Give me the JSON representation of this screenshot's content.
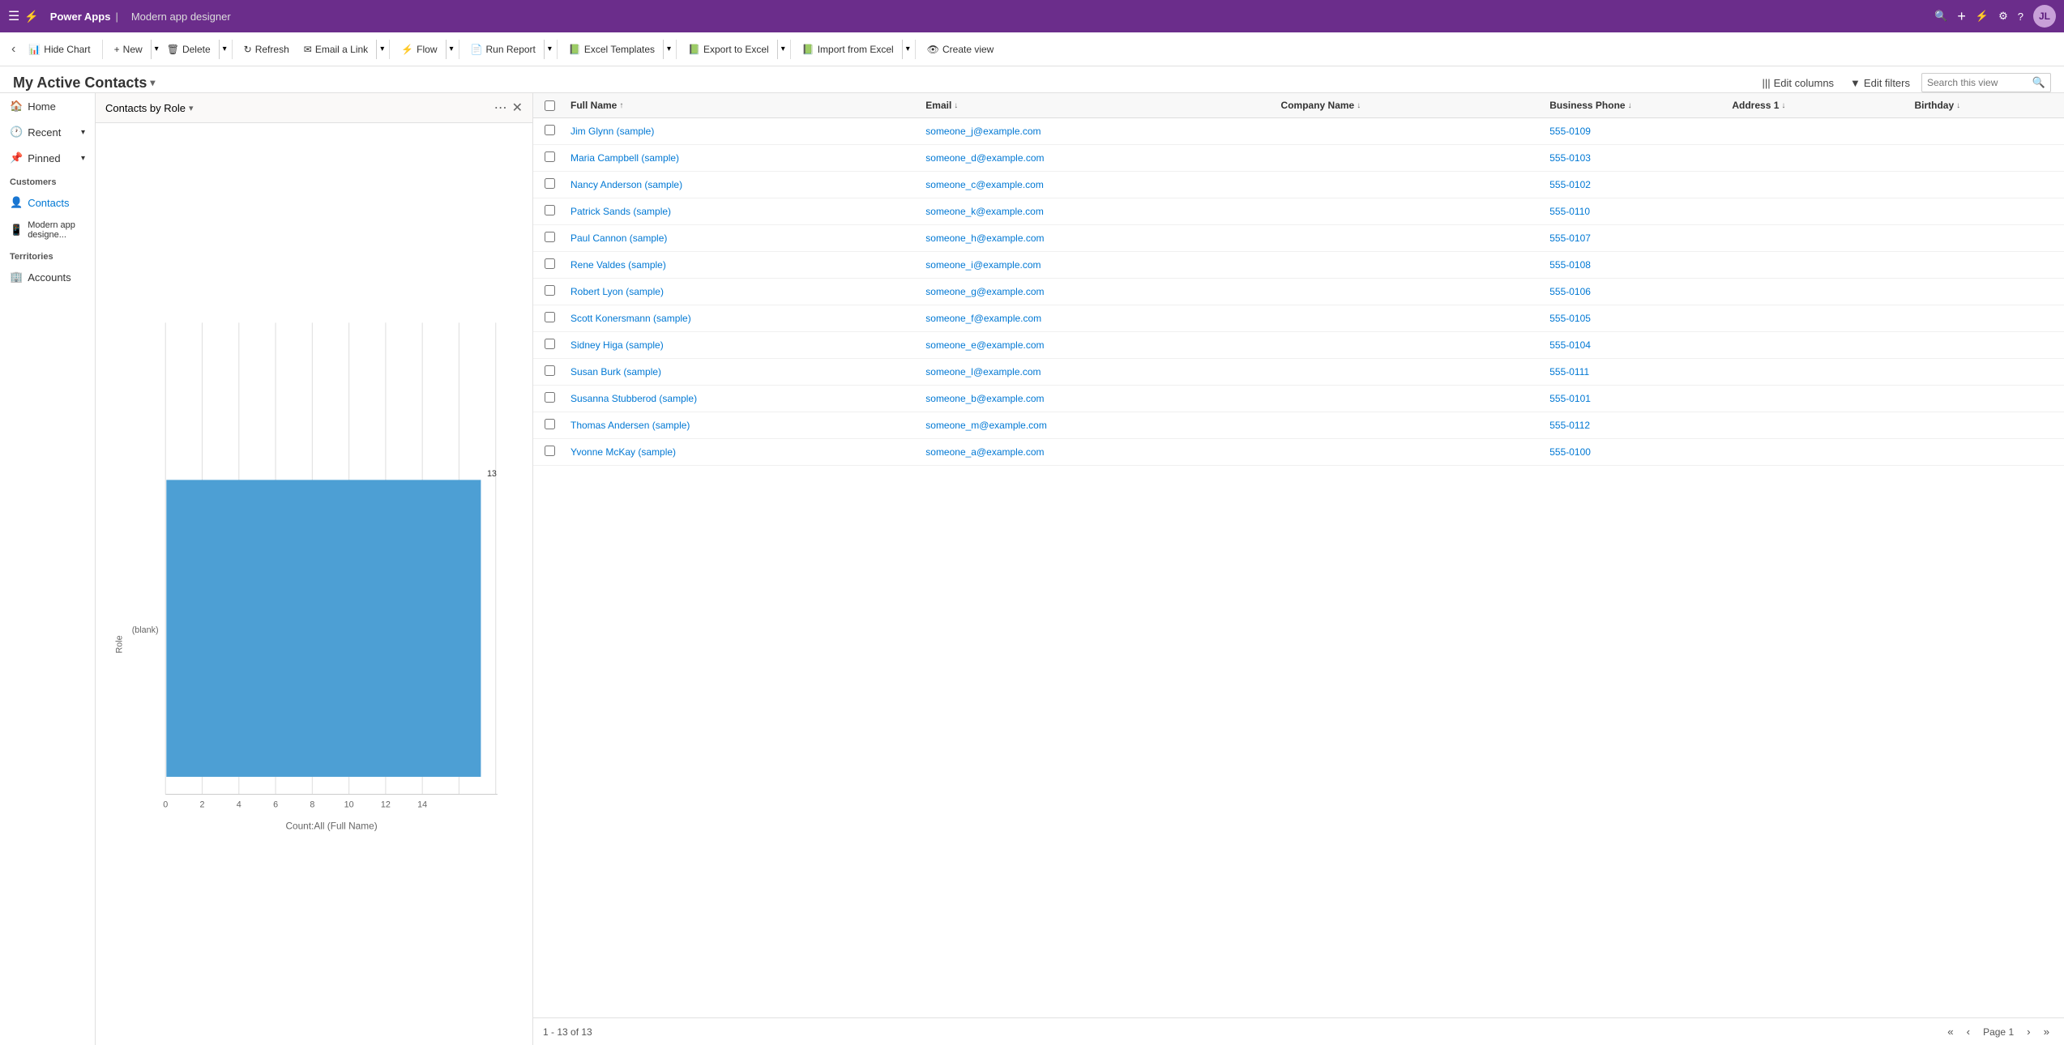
{
  "topbar": {
    "app_name": "Power Apps",
    "designer_name": "Modern app designer",
    "avatar_initials": "JL"
  },
  "toolbar": {
    "hide_chart": "Hide Chart",
    "new": "New",
    "delete": "Delete",
    "refresh": "Refresh",
    "email_a_link": "Email a Link",
    "flow": "Flow",
    "run_report": "Run Report",
    "excel_templates": "Excel Templates",
    "export_to_excel": "Export to Excel",
    "import_from_excel": "Import from Excel",
    "create_view": "Create view"
  },
  "view_header": {
    "title": "My Active Contacts",
    "edit_columns": "Edit columns",
    "edit_filters": "Edit filters",
    "search_placeholder": "Search this view"
  },
  "sidebar": {
    "nav_items": [
      {
        "label": "Home",
        "icon": "🏠"
      },
      {
        "label": "Recent",
        "icon": "🕐",
        "has_expand": true
      },
      {
        "label": "Pinned",
        "icon": "📌",
        "has_expand": true
      }
    ],
    "customers_section": "Customers",
    "customer_items": [
      {
        "label": "Contacts",
        "icon": "👤",
        "active": true
      },
      {
        "label": "Modern app designe...",
        "icon": "📱"
      }
    ],
    "territories_section": "Territories",
    "territory_items": [
      {
        "label": "Accounts",
        "icon": "🏢"
      }
    ]
  },
  "chart": {
    "title": "Contacts by Role",
    "bar_label_blank": "(blank)",
    "bar_label_role": "Role",
    "bar_value": "13",
    "x_axis_title": "Count:All (Full Name)",
    "x_labels": [
      "0",
      "2",
      "4",
      "6",
      "8",
      "10",
      "12",
      "14"
    ],
    "bar_color": "#4d9fd4"
  },
  "grid": {
    "columns": [
      {
        "label": "Full Name",
        "sort": "↑",
        "key": "fullname"
      },
      {
        "label": "Email",
        "sort": "↓",
        "key": "email"
      },
      {
        "label": "Company Name",
        "sort": "↓",
        "key": "company"
      },
      {
        "label": "Business Phone",
        "sort": "↓",
        "key": "phone"
      },
      {
        "label": "Address 1",
        "sort": "↓",
        "key": "address"
      },
      {
        "label": "Birthday",
        "sort": "↓",
        "key": "birthday"
      }
    ],
    "rows": [
      {
        "fullname": "Jim Glynn (sample)",
        "email": "someone_j@example.com",
        "company": "",
        "phone": "555-0109",
        "address": "",
        "birthday": ""
      },
      {
        "fullname": "Maria Campbell (sample)",
        "email": "someone_d@example.com",
        "company": "",
        "phone": "555-0103",
        "address": "",
        "birthday": ""
      },
      {
        "fullname": "Nancy Anderson (sample)",
        "email": "someone_c@example.com",
        "company": "",
        "phone": "555-0102",
        "address": "",
        "birthday": ""
      },
      {
        "fullname": "Patrick Sands (sample)",
        "email": "someone_k@example.com",
        "company": "",
        "phone": "555-0110",
        "address": "",
        "birthday": ""
      },
      {
        "fullname": "Paul Cannon (sample)",
        "email": "someone_h@example.com",
        "company": "",
        "phone": "555-0107",
        "address": "",
        "birthday": ""
      },
      {
        "fullname": "Rene Valdes (sample)",
        "email": "someone_i@example.com",
        "company": "",
        "phone": "555-0108",
        "address": "",
        "birthday": ""
      },
      {
        "fullname": "Robert Lyon (sample)",
        "email": "someone_g@example.com",
        "company": "",
        "phone": "555-0106",
        "address": "",
        "birthday": ""
      },
      {
        "fullname": "Scott Konersmann (sample)",
        "email": "someone_f@example.com",
        "company": "",
        "phone": "555-0105",
        "address": "",
        "birthday": ""
      },
      {
        "fullname": "Sidney Higa (sample)",
        "email": "someone_e@example.com",
        "company": "",
        "phone": "555-0104",
        "address": "",
        "birthday": ""
      },
      {
        "fullname": "Susan Burk (sample)",
        "email": "someone_l@example.com",
        "company": "",
        "phone": "555-0111",
        "address": "",
        "birthday": ""
      },
      {
        "fullname": "Susanna Stubberod (sample)",
        "email": "someone_b@example.com",
        "company": "",
        "phone": "555-0101",
        "address": "",
        "birthday": ""
      },
      {
        "fullname": "Thomas Andersen (sample)",
        "email": "someone_m@example.com",
        "company": "",
        "phone": "555-0112",
        "address": "",
        "birthday": ""
      },
      {
        "fullname": "Yvonne McKay (sample)",
        "email": "someone_a@example.com",
        "company": "",
        "phone": "555-0100",
        "address": "",
        "birthday": ""
      }
    ],
    "footer": {
      "count_text": "1 - 13 of 13",
      "page_text": "Page 1"
    }
  }
}
